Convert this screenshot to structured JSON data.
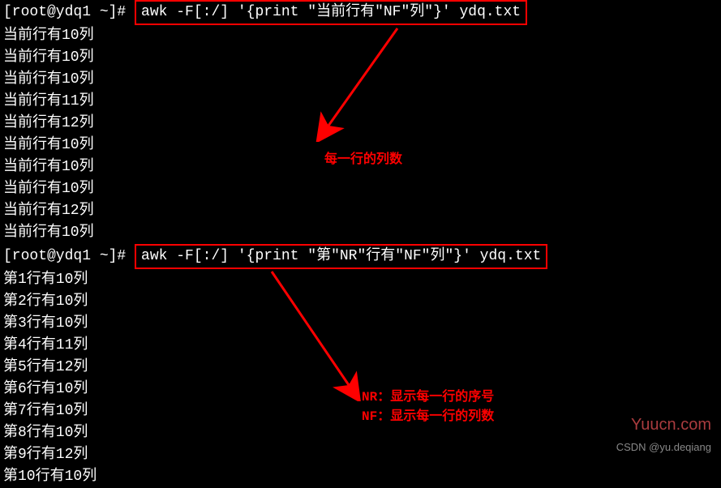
{
  "prompt1": {
    "prefix": "[root@ydq1 ~]# ",
    "command": "awk -F[:/] '{print \"当前行有\"NF\"列\"}' ydq.txt"
  },
  "output1": [
    "当前行有10列",
    "当前行有10列",
    "当前行有10列",
    "当前行有11列",
    "当前行有12列",
    "当前行有10列",
    "当前行有10列",
    "当前行有10列",
    "当前行有12列",
    "当前行有10列"
  ],
  "prompt2": {
    "prefix": "[root@ydq1 ~]# ",
    "command": "awk -F[:/] '{print \"第\"NR\"行有\"NF\"列\"}' ydq.txt"
  },
  "output2": [
    "第1行有10列",
    "第2行有10列",
    "第3行有10列",
    "第4行有11列",
    "第5行有12列",
    "第6行有10列",
    "第7行有10列",
    "第8行有10列",
    "第9行有12列",
    "第10行有10列"
  ],
  "annotation1": "每一行的列数",
  "annotation2_line1": "NR：显示每一行的序号",
  "annotation2_line2": "NF：显示每一行的列数",
  "watermark": "Yuucn.com",
  "credit": "CSDN @yu.deqiang"
}
